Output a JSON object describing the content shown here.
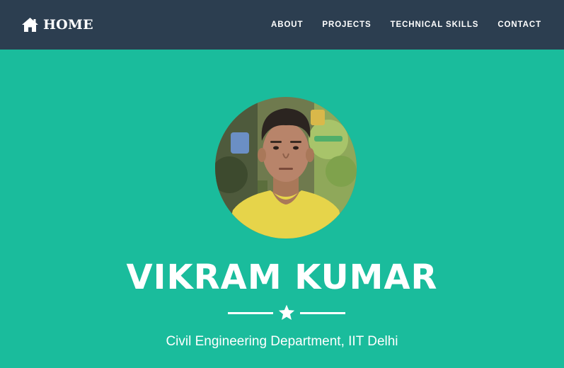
{
  "navbar": {
    "brand_label": "HOME",
    "brand_icon": "home-icon",
    "links": [
      {
        "label": "ABOUT"
      },
      {
        "label": "PROJECTS"
      },
      {
        "label": "TECHNICAL SKILLS"
      },
      {
        "label": "CONTACT"
      }
    ]
  },
  "masthead": {
    "name": "VIKRAM KUMAR",
    "divider_icon": "star-icon",
    "subtitle": "Civil Engineering Department, IIT Delhi"
  },
  "colors": {
    "navbar_bg": "#2c3e50",
    "masthead_bg": "#1abc9c",
    "text": "#ffffff"
  }
}
